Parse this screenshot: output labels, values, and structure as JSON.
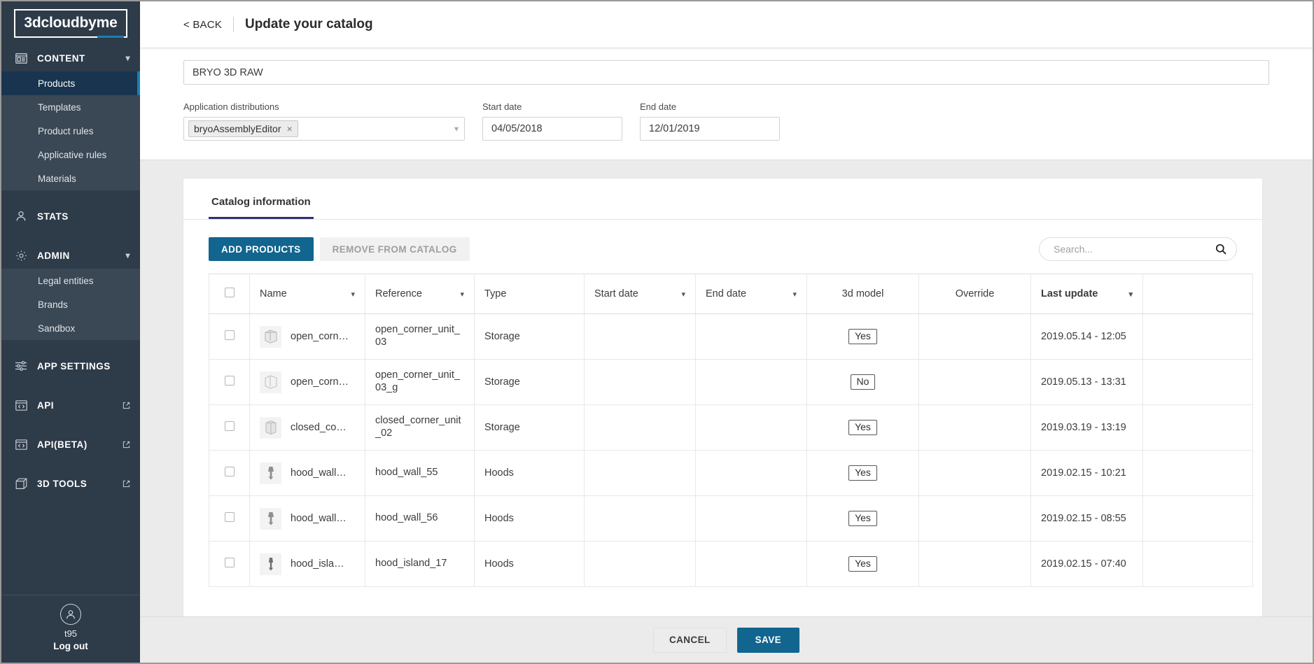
{
  "sidebar": {
    "logo": "3dcloudbyme",
    "groups": [
      {
        "icon": "content-icon",
        "label": "CONTENT",
        "expanded": true,
        "items": [
          {
            "label": "Products",
            "active": true
          },
          {
            "label": "Templates",
            "active": false
          },
          {
            "label": "Product rules",
            "active": false
          },
          {
            "label": "Applicative rules",
            "active": false
          },
          {
            "label": "Materials",
            "active": false
          }
        ]
      },
      {
        "icon": "user-icon",
        "label": "STATS",
        "expanded": false,
        "items": []
      },
      {
        "icon": "gear-icon",
        "label": "ADMIN",
        "expanded": true,
        "items": [
          {
            "label": "Legal entities",
            "active": false
          },
          {
            "label": "Brands",
            "active": false
          },
          {
            "label": "Sandbox",
            "active": false
          }
        ]
      },
      {
        "icon": "sliders-icon",
        "label": "APP SETTINGS",
        "expanded": false,
        "items": []
      },
      {
        "icon": "code-window-icon",
        "label": "API",
        "external": true,
        "items": []
      },
      {
        "icon": "code-window-icon",
        "label": "API(BETA)",
        "external": true,
        "items": []
      },
      {
        "icon": "cube-icon",
        "label": "3D TOOLS",
        "external": true,
        "items": []
      }
    ],
    "footer": {
      "avatar_icon": "user-avatar-icon",
      "user": "t95",
      "logout_label": "Log out"
    }
  },
  "topbar": {
    "back_label": "< BACK",
    "title": "Update your catalog"
  },
  "form": {
    "catalog_name": "BRYO 3D RAW",
    "catalog_name_placeholder": "Catalog name",
    "application_distributions": {
      "label": "Application distributions",
      "chips": [
        "bryoAssemblyEditor"
      ],
      "chip_remove_glyph": "×",
      "chevron": "chevron-down-icon"
    },
    "start_date": {
      "label": "Start date",
      "value": "04/05/2018"
    },
    "end_date": {
      "label": "End date",
      "value": "12/01/2019"
    }
  },
  "card": {
    "tabs": [
      {
        "label": "Catalog information",
        "active": true
      }
    ],
    "toolbar": {
      "add_products_label": "ADD PRODUCTS",
      "remove_from_catalog_label": "REMOVE FROM CATALOG",
      "search_placeholder": "Search...",
      "search_value": "",
      "search_icon": "search-icon"
    },
    "table": {
      "columns": [
        {
          "key": "check",
          "label": "",
          "sortable": false,
          "sorted": false
        },
        {
          "key": "name",
          "label": "Name",
          "sortable": true,
          "sorted": false
        },
        {
          "key": "reference",
          "label": "Reference",
          "sortable": true,
          "sorted": false
        },
        {
          "key": "type",
          "label": "Type",
          "sortable": false,
          "sorted": false
        },
        {
          "key": "start_date",
          "label": "Start date",
          "sortable": true,
          "sorted": false
        },
        {
          "key": "end_date",
          "label": "End date",
          "sortable": true,
          "sorted": false
        },
        {
          "key": "model3d",
          "label": "3d model",
          "sortable": false,
          "sorted": false
        },
        {
          "key": "override",
          "label": "Override",
          "sortable": false,
          "sorted": false
        },
        {
          "key": "last_update",
          "label": "Last update",
          "sortable": true,
          "sorted": true
        },
        {
          "key": "actions",
          "label": "",
          "sortable": false,
          "sorted": false
        }
      ],
      "rows": [
        {
          "checked": false,
          "thumb": "cabinet-thumbnail",
          "name": "open_corn…",
          "reference": "open_corner_unit_03",
          "type": "Storage",
          "start_date": "",
          "end_date": "",
          "model3d": "Yes",
          "override": "",
          "last_update": "2019.05.14 - 12:05"
        },
        {
          "checked": false,
          "thumb": "cabinet-thumbnail",
          "name": "open_corn…",
          "reference": "open_corner_unit_03_g",
          "type": "Storage",
          "start_date": "",
          "end_date": "",
          "model3d": "No",
          "override": "",
          "last_update": "2019.05.13 - 13:31"
        },
        {
          "checked": false,
          "thumb": "cabinet-thumbnail",
          "name": "closed_co…",
          "reference": "closed_corner_unit_02",
          "type": "Storage",
          "start_date": "",
          "end_date": "",
          "model3d": "Yes",
          "override": "",
          "last_update": "2019.03.19 - 13:19"
        },
        {
          "checked": false,
          "thumb": "hood-thumbnail",
          "name": "hood_wall…",
          "reference": "hood_wall_55",
          "type": "Hoods",
          "start_date": "",
          "end_date": "",
          "model3d": "Yes",
          "override": "",
          "last_update": "2019.02.15 - 10:21"
        },
        {
          "checked": false,
          "thumb": "hood-thumbnail",
          "name": "hood_wall…",
          "reference": "hood_wall_56",
          "type": "Hoods",
          "start_date": "",
          "end_date": "",
          "model3d": "Yes",
          "override": "",
          "last_update": "2019.02.15 - 08:55"
        },
        {
          "checked": false,
          "thumb": "hood-thumbnail",
          "name": "hood_isla…",
          "reference": "hood_island_17",
          "type": "Hoods",
          "start_date": "",
          "end_date": "",
          "model3d": "Yes",
          "override": "",
          "last_update": "2019.02.15 - 07:40"
        }
      ]
    }
  },
  "footer": {
    "cancel_label": "CANCEL",
    "save_label": "SAVE"
  },
  "colors": {
    "sidebar_bg": "#2e3b49",
    "sidebar_sub_bg": "#3a4754",
    "active_item_bg": "#18344e",
    "accent_blue": "#1b7fb0",
    "primary_button": "#11658f",
    "tab_underline": "#2e3271"
  }
}
